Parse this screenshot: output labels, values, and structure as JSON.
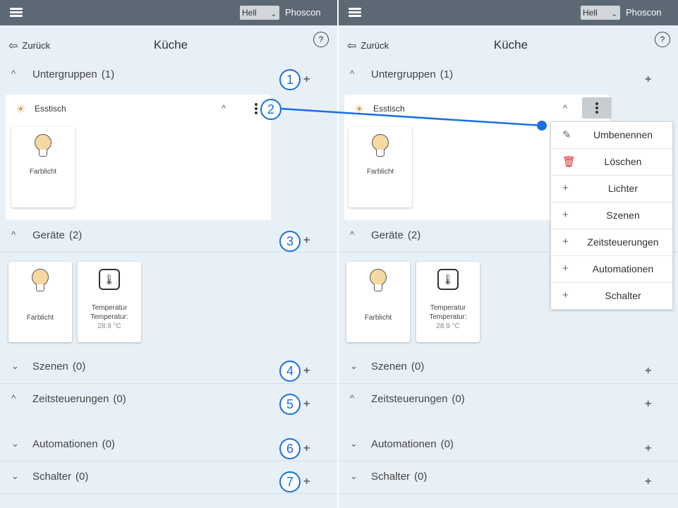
{
  "header": {
    "theme_value": "Hell",
    "brand": "Phoscon"
  },
  "nav": {
    "back_label": "Zurück",
    "page_title": "Küche",
    "help_label": "?"
  },
  "sections": {
    "untergruppen": {
      "label": "Untergruppen",
      "count": "(1)"
    },
    "geraete": {
      "label": "Geräte",
      "count": "(2)"
    },
    "szenen": {
      "label": "Szenen",
      "count": "(0)"
    },
    "zeitsteuerungen": {
      "label": "Zeitsteuerungen",
      "count": "(0)"
    },
    "automationen": {
      "label": "Automationen",
      "count": "(0)"
    },
    "schalter": {
      "label": "Schalter",
      "count": "(0)"
    }
  },
  "group": {
    "name": "Esstisch",
    "light_name": "Farblicht"
  },
  "devices": {
    "light_name": "Farblicht",
    "sensor_name": "Temperatur",
    "sensor_label": "Temperatur:",
    "sensor_value": "28.9 °C"
  },
  "badges": [
    "1",
    "2",
    "3",
    "4",
    "5",
    "6",
    "7"
  ],
  "context_menu": [
    {
      "label": "Umbenennen",
      "icon": "pencil-icon"
    },
    {
      "label": "Löschen",
      "icon": "trash-icon",
      "color": "#d32f2f"
    },
    {
      "label": "Lichter",
      "icon": "plus-icon"
    },
    {
      "label": "Szenen",
      "icon": "plus-icon"
    },
    {
      "label": "Zeitsteuerungen",
      "icon": "plus-icon"
    },
    {
      "label": "Automationen",
      "icon": "plus-icon"
    },
    {
      "label": "Schalter",
      "icon": "plus-icon"
    }
  ],
  "colors": {
    "header_bg": "#5c6873",
    "page_bg": "#e8f0f7",
    "annotation": "#1a6ee6"
  }
}
